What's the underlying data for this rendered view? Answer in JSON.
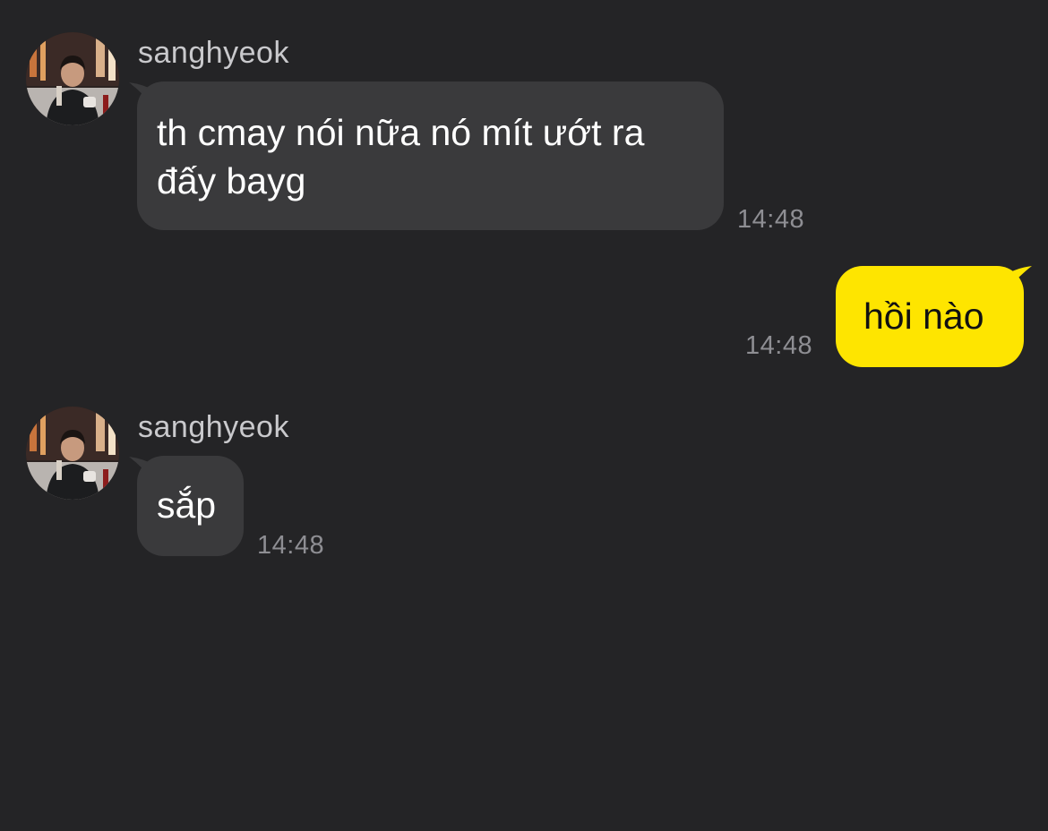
{
  "theme": {
    "background": "#242426",
    "incoming_bubble": "#3a3a3c",
    "outgoing_bubble": "#fee500",
    "timestamp_color": "#8e8e93"
  },
  "messages": [
    {
      "direction": "incoming",
      "sender": "sanghyeok",
      "avatar_icon": "profile-photo-avatar",
      "lines": [
        "th cmay nói nữa nó mít ướt ra",
        "đấy bayg"
      ],
      "time": "14:48"
    },
    {
      "direction": "outgoing",
      "lines": [
        "hồi nào"
      ],
      "time": "14:48"
    },
    {
      "direction": "incoming",
      "sender": "sanghyeok",
      "avatar_icon": "profile-photo-avatar",
      "lines": [
        "sắp"
      ],
      "time": "14:48"
    }
  ]
}
